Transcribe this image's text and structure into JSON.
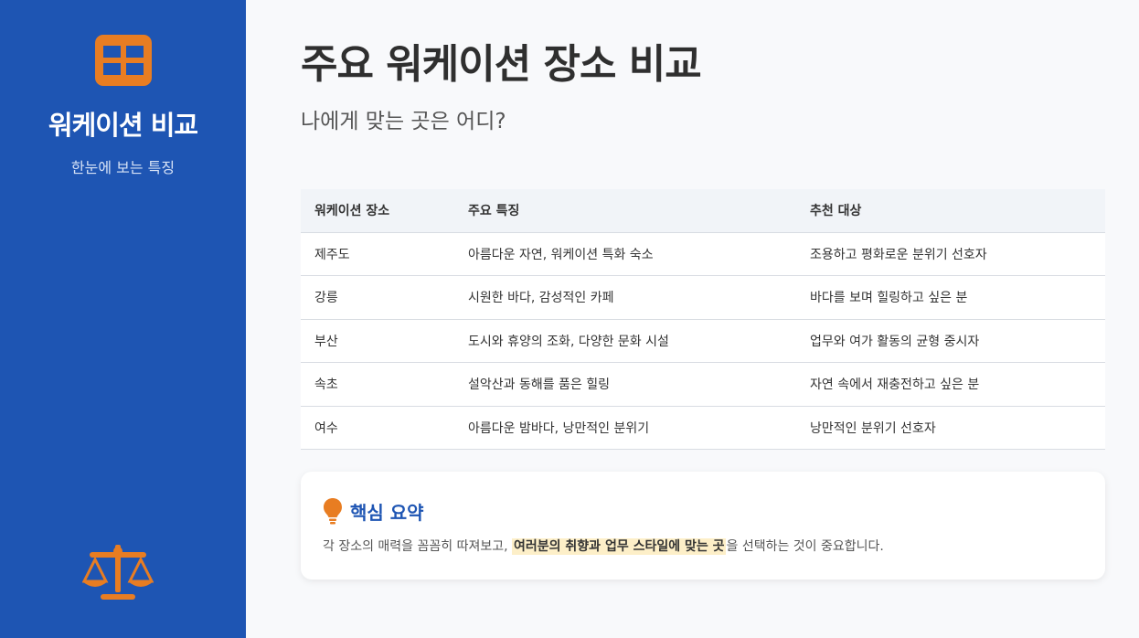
{
  "sidebar": {
    "logo_icon": "table-icon",
    "title": "워케이션 비교",
    "subtitle": "한눈에 보는 특징",
    "bottom_icon": "balance-scale-icon",
    "accent_color": "#e87d22",
    "bg_color": "#1e55b3"
  },
  "header": {
    "title": "주요 워케이션 장소 비교",
    "subtitle": "나에게 맞는 곳은 어디?"
  },
  "table": {
    "columns": [
      "워케이션 장소",
      "주요 특징",
      "추천 대상"
    ],
    "rows": [
      [
        "제주도",
        "아름다운 자연, 워케이션 특화 숙소",
        "조용하고 평화로운 분위기 선호자"
      ],
      [
        "강릉",
        "시원한 바다, 감성적인 카페",
        "바다를 보며 힐링하고 싶은 분"
      ],
      [
        "부산",
        "도시와 휴양의 조화, 다양한 문화 시설",
        "업무와 여가 활동의 균형 중시자"
      ],
      [
        "속초",
        "설악산과 동해를 품은 힐링",
        "자연 속에서 재충전하고 싶은 분"
      ],
      [
        "여수",
        "아름다운 밤바다, 낭만적인 분위기",
        "낭만적인 분위기 선호자"
      ]
    ]
  },
  "summary": {
    "icon": "lightbulb-icon",
    "title": "핵심 요약",
    "text_before": "각 장소의 매력을 꼼꼼히 따져보고, ",
    "text_highlight": "여러분의 취향과 업무 스타일에 맞는 곳",
    "text_after": "을 선택하는 것이 중요합니다."
  }
}
